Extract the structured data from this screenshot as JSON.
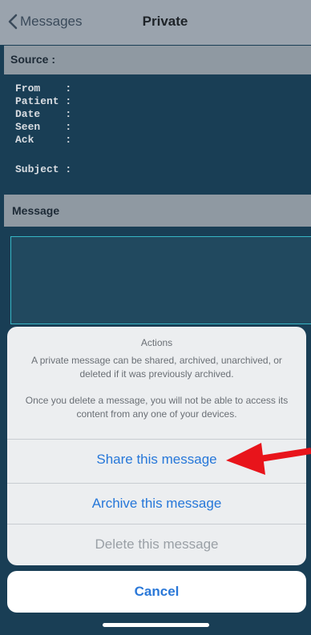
{
  "nav": {
    "back_label": "Messages",
    "title": "Private"
  },
  "source": {
    "header": "Source :",
    "fields": [
      {
        "label": "From    :"
      },
      {
        "label": "Patient :"
      },
      {
        "label": "Date    :"
      },
      {
        "label": "Seen    :"
      },
      {
        "label": "Ack     :"
      }
    ],
    "subject_label": "Subject :"
  },
  "message": {
    "header": "Message"
  },
  "action_sheet": {
    "title": "Actions",
    "description_1": "A private message can be shared, archived, unarchived, or deleted if it was previously archived.",
    "description_2": "Once you delete a message, you will not be able to access its content from any one of your devices.",
    "share_label": "Share this message",
    "archive_label": "Archive this message",
    "delete_label": "Delete this message",
    "cancel_label": "Cancel"
  },
  "colors": {
    "accent": "#2677d9",
    "arrow": "#e8141b",
    "background": "#193e55"
  },
  "icons": {
    "back": "chevron-left-icon",
    "arrow": "red-arrow-annotation"
  }
}
